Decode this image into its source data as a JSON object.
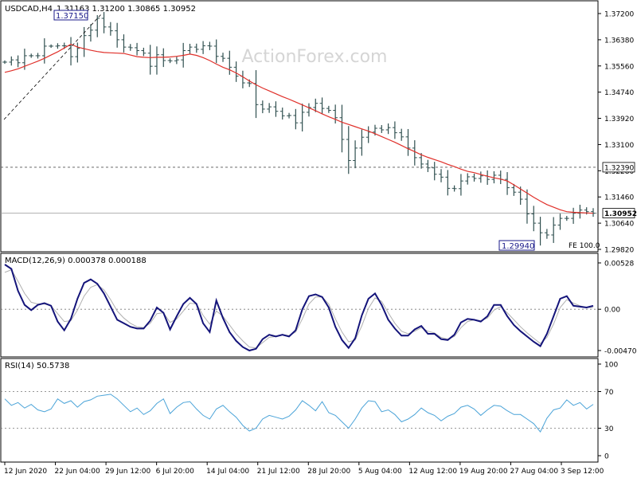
{
  "colors": {
    "background": "#ffffff",
    "frame": "#000000",
    "price_bars": "#2f4f4f",
    "moving_average": "#e0302a",
    "macd_main": "#14147a",
    "macd_signal": "#b0b0b0",
    "rsi_line": "#4aa3d8",
    "watermark": "#d5d5d5",
    "dashed_level": "#555555"
  },
  "watermark": "ActionForex.com",
  "chart_data": [
    {
      "type": "line",
      "name": "price",
      "title": "USDCAD,H4",
      "ohlc_header": "1.31163 1.31200 1.30865 1.30952",
      "y_ticks": [
        "1.37200",
        "1.36380",
        "1.35560",
        "1.34740",
        "1.33920",
        "1.33100",
        "1.32280",
        "1.31460",
        "1.30640",
        "1.29820"
      ],
      "ylim": [
        1.2982,
        1.372
      ],
      "x_ticks": [
        "12 Jun 2020",
        "22 Jun 04:00",
        "29 Jun 12:00",
        "6 Jul 20:00",
        "14 Jul 04:00",
        "21 Jul 12:00",
        "28 Jul 20:00",
        "5 Aug 04:00",
        "12 Aug 12:00",
        "19 Aug 20:00",
        "27 Aug 04:00",
        "3 Sep 12:00"
      ],
      "close": [
        1.3568,
        1.3575,
        1.3566,
        1.3588,
        1.3588,
        1.3588,
        1.3618,
        1.3618,
        1.3619,
        1.3619,
        1.3585,
        1.3611,
        1.3651,
        1.3668,
        1.3705,
        1.3678,
        1.3666,
        1.3638,
        1.3615,
        1.3613,
        1.3604,
        1.3596,
        1.3555,
        1.3591,
        1.3573,
        1.3572,
        1.3575,
        1.3604,
        1.3615,
        1.3608,
        1.3619,
        1.3618,
        1.3586,
        1.358,
        1.3552,
        1.3524,
        1.3503,
        1.3501,
        1.3435,
        1.3421,
        1.3428,
        1.3414,
        1.34,
        1.3401,
        1.3378,
        1.3411,
        1.3426,
        1.3439,
        1.3423,
        1.3417,
        1.3394,
        1.3326,
        1.326,
        1.3299,
        1.3333,
        1.3349,
        1.3361,
        1.3356,
        1.3363,
        1.3347,
        1.3334,
        1.3299,
        1.3269,
        1.3249,
        1.3237,
        1.3217,
        1.3208,
        1.3173,
        1.3172,
        1.3196,
        1.3209,
        1.3204,
        1.3212,
        1.3201,
        1.3214,
        1.3201,
        1.3175,
        1.3161,
        1.3139,
        1.3093,
        1.3064,
        1.3034,
        1.3027,
        1.3058,
        1.3079,
        1.3079,
        1.3095,
        1.3105,
        1.31,
        1.3095
      ],
      "moving_average": [
        1.3536,
        1.3541,
        1.3547,
        1.3555,
        1.3563,
        1.3571,
        1.358,
        1.359,
        1.36,
        1.3612,
        1.3624,
        1.3615,
        1.361,
        1.3605,
        1.3601,
        1.3598,
        1.3597,
        1.3596,
        1.3595,
        1.359,
        1.3585,
        1.3583,
        1.3582,
        1.3583,
        1.3583,
        1.3584,
        1.3586,
        1.3589,
        1.3593,
        1.3589,
        1.3582,
        1.3573,
        1.3562,
        1.3552,
        1.3544,
        1.3534,
        1.3522,
        1.3509,
        1.3497,
        1.3487,
        1.3478,
        1.3469,
        1.346,
        1.3452,
        1.3443,
        1.3434,
        1.3425,
        1.3416,
        1.3406,
        1.3397,
        1.3389,
        1.338,
        1.3373,
        1.3366,
        1.3359,
        1.3352,
        1.3344,
        1.3335,
        1.3326,
        1.3317,
        1.3307,
        1.3297,
        1.3288,
        1.3278,
        1.327,
        1.3263,
        1.3256,
        1.3248,
        1.3241,
        1.3233,
        1.3226,
        1.3222,
        1.3216,
        1.3211,
        1.3206,
        1.3202,
        1.3196,
        1.3184,
        1.3171,
        1.3158,
        1.3145,
        1.3133,
        1.3122,
        1.3114,
        1.3106,
        1.31,
        1.3098,
        1.3097,
        1.3096,
        1.3095
      ],
      "annotations": {
        "high": {
          "label": "1.37150",
          "value": 1.3715
        },
        "low": {
          "label": "1.29940",
          "value": 1.2994
        },
        "level": {
          "label": "1.32390",
          "value": 1.3239
        },
        "current": {
          "label": "1.30952",
          "value": 1.30952
        },
        "fe_label": "FE 100.0"
      }
    },
    {
      "type": "line",
      "name": "macd",
      "title": "MACD(12,26,9) 0.000378 0.000188",
      "y_ticks": [
        "0.00528",
        "0.00",
        "-0.004701"
      ],
      "ylim": [
        -0.004701,
        0.00528
      ],
      "main": [
        0.0051,
        0.0046,
        0.0021,
        0.0005,
        -0.0001,
        0.0005,
        0.0007,
        0.0004,
        -0.0014,
        -0.0024,
        -0.0011,
        0.0012,
        0.003,
        0.0034,
        0.0029,
        0.0018,
        0.0003,
        -0.0012,
        -0.0016,
        -0.002,
        -0.0022,
        -0.0022,
        -0.0013,
        0.0002,
        -0.0004,
        -0.0023,
        -0.0008,
        0.0006,
        0.0013,
        0.0006,
        -0.0016,
        -0.0026,
        0.001,
        -0.001,
        -0.0026,
        -0.0036,
        -0.0043,
        -0.0047,
        -0.0045,
        -0.0034,
        -0.0029,
        -0.0031,
        -0.0029,
        -0.0031,
        -0.0024,
        0.0,
        0.0015,
        0.0017,
        0.0014,
        0.0002,
        -0.002,
        -0.0035,
        -0.0044,
        -0.0033,
        -0.0007,
        0.0012,
        0.0018,
        0.0005,
        -0.0012,
        -0.0022,
        -0.003,
        -0.003,
        -0.0023,
        -0.0019,
        -0.0028,
        -0.0028,
        -0.0034,
        -0.0035,
        -0.0029,
        -0.0015,
        -0.0011,
        -0.0012,
        -0.0014,
        -0.0008,
        0.0005,
        0.0005,
        -0.0008,
        -0.0018,
        -0.0025,
        -0.0031,
        -0.0037,
        -0.0042,
        -0.0028,
        -0.0008,
        0.0012,
        0.0015,
        0.0004,
        0.0003,
        0.0002,
        0.0004
      ],
      "signal": [
        0.0042,
        0.0045,
        0.0032,
        0.0018,
        0.0008,
        0.0006,
        0.0006,
        0.0004,
        -0.0005,
        -0.0014,
        -0.0013,
        -0.0001,
        0.0015,
        0.0025,
        0.0028,
        0.0022,
        0.0011,
        -0.0002,
        -0.001,
        -0.0016,
        -0.002,
        -0.0021,
        -0.0016,
        -0.0005,
        -0.0004,
        -0.0015,
        -0.0011,
        -0.0002,
        0.0007,
        0.0006,
        -0.0007,
        -0.0017,
        -0.0002,
        -0.0008,
        -0.0018,
        -0.0028,
        -0.0036,
        -0.0043,
        -0.0044,
        -0.0038,
        -0.0032,
        -0.0031,
        -0.0029,
        -0.003,
        -0.0026,
        -0.0011,
        0.0006,
        0.0014,
        0.0014,
        0.0006,
        -0.0011,
        -0.0026,
        -0.0037,
        -0.0035,
        -0.0019,
        0.0001,
        0.0013,
        0.0009,
        -0.0004,
        -0.0016,
        -0.0025,
        -0.0028,
        -0.0025,
        -0.0021,
        -0.0025,
        -0.0027,
        -0.0032,
        -0.0034,
        -0.0031,
        -0.0021,
        -0.0014,
        -0.0012,
        -0.0013,
        -0.001,
        -0.0001,
        0.0003,
        -0.0004,
        -0.0012,
        -0.002,
        -0.0027,
        -0.0033,
        -0.0039,
        -0.0032,
        -0.0017,
        0.0002,
        0.0011,
        0.0007,
        0.0004,
        0.0002,
        0.0002
      ]
    },
    {
      "type": "line",
      "name": "rsi",
      "title": "RSI(14) 50.5738",
      "y_ticks": [
        "100",
        "70",
        "30",
        "0"
      ],
      "ylim": [
        0,
        100
      ],
      "levels": [
        70,
        30
      ],
      "values": [
        62,
        55,
        58,
        52,
        56,
        50,
        48,
        51,
        62,
        57,
        60,
        53,
        59,
        61,
        65,
        66,
        67,
        62,
        55,
        48,
        52,
        45,
        49,
        57,
        62,
        46,
        53,
        58,
        59,
        51,
        44,
        40,
        51,
        55,
        48,
        42,
        33,
        27,
        30,
        40,
        44,
        42,
        40,
        43,
        50,
        60,
        55,
        49,
        59,
        47,
        44,
        37,
        30,
        40,
        52,
        60,
        59,
        48,
        50,
        45,
        37,
        40,
        45,
        52,
        47,
        44,
        38,
        43,
        46,
        53,
        55,
        51,
        44,
        50,
        55,
        54,
        49,
        45,
        45,
        40,
        35,
        26,
        41,
        50,
        52,
        61,
        55,
        58,
        51,
        56
      ]
    }
  ]
}
